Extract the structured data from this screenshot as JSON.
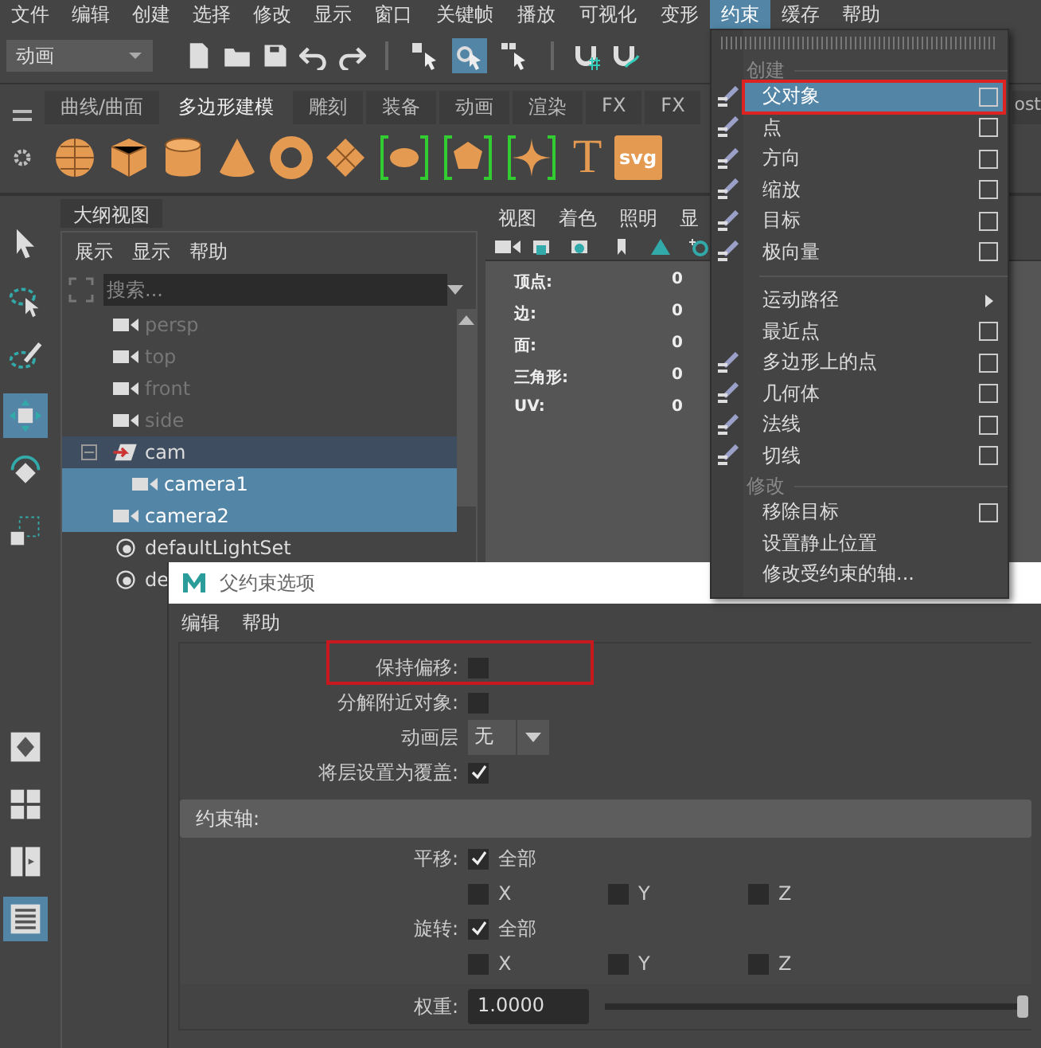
{
  "menubar": [
    {
      "label": "文件",
      "selected": false
    },
    {
      "label": "编辑",
      "selected": false
    },
    {
      "label": "创建",
      "selected": false
    },
    {
      "label": "选择",
      "selected": false
    },
    {
      "label": "修改",
      "selected": false
    },
    {
      "label": "显示",
      "selected": false
    },
    {
      "label": "窗口",
      "selected": false
    },
    {
      "label": "关键帧",
      "selected": false
    },
    {
      "label": "播放",
      "selected": false
    },
    {
      "label": "可视化",
      "selected": false
    },
    {
      "label": "变形",
      "selected": false
    },
    {
      "label": "约束",
      "selected": true
    },
    {
      "label": "缓存",
      "selected": false
    },
    {
      "label": "帮助",
      "selected": false
    }
  ],
  "status_line": {
    "mode": "动画",
    "tools": [
      {
        "kind": "hierarchy",
        "selected": false
      },
      {
        "kind": "object",
        "selected": true
      },
      {
        "kind": "component",
        "selected": false
      }
    ]
  },
  "shelf": {
    "tabs": [
      {
        "label": "曲线/曲面",
        "selected": false
      },
      {
        "label": "多边形建模",
        "selected": true
      },
      {
        "label": "雕刻",
        "selected": false
      },
      {
        "label": "装备",
        "selected": false
      },
      {
        "label": "动画",
        "selected": false
      },
      {
        "label": "渲染",
        "selected": false
      },
      {
        "label": "FX",
        "selected": false
      },
      {
        "label": "FX",
        "selected": false
      },
      {
        "label": "ost",
        "selected": false
      }
    ],
    "icons": [
      {
        "kind": "sphere"
      },
      {
        "kind": "cube"
      },
      {
        "kind": "cylinder"
      },
      {
        "kind": "cone"
      },
      {
        "kind": "torus"
      },
      {
        "kind": "plane"
      },
      {
        "kind": "disc"
      },
      {
        "kind": "platonic"
      },
      {
        "kind": "star"
      },
      {
        "kind": "glyph",
        "glyph": "T"
      },
      {
        "kind": "badge",
        "glyph": "svg"
      }
    ]
  },
  "toolbox": [
    {
      "kind": "select",
      "selected": false
    },
    {
      "kind": "lasso",
      "selected": false
    },
    {
      "kind": "paint",
      "selected": false
    },
    {
      "kind": "move",
      "selected": true
    },
    {
      "kind": "rotate",
      "selected": false
    },
    {
      "kind": "scale",
      "selected": false
    },
    {
      "kind": "single",
      "selected": false
    },
    {
      "kind": "grid",
      "selected": false
    },
    {
      "kind": "split",
      "selected": false
    },
    {
      "kind": "list",
      "selected": true
    }
  ],
  "outliner": {
    "title": "大纲视图",
    "menu": [
      "展示",
      "显示",
      "帮助"
    ],
    "search": {
      "placeholder": "搜索..."
    },
    "items": [
      {
        "label": "persp",
        "kind": "camera",
        "dimmed": true,
        "selected": false
      },
      {
        "label": "top",
        "kind": "camera",
        "dimmed": true,
        "selected": false
      },
      {
        "label": "front",
        "kind": "camera",
        "dimmed": true,
        "selected": false
      },
      {
        "label": "side",
        "kind": "camera",
        "dimmed": true,
        "selected": false
      },
      {
        "label": "cam",
        "kind": "group",
        "dimmed": false,
        "selected": false,
        "expanded": true,
        "children": [
          {
            "label": "camera1",
            "kind": "camera",
            "dimmed": false,
            "selected": true
          }
        ]
      },
      {
        "label": "camera2",
        "kind": "camera",
        "dimmed": false,
        "selected": true
      },
      {
        "label": "defaultLightSet",
        "kind": "set",
        "dimmed": false,
        "selected": false
      },
      {
        "label": "de",
        "kind": "set",
        "dimmed": false,
        "selected": false
      }
    ]
  },
  "viewport": {
    "menu": [
      "视图",
      "着色",
      "照明",
      "显"
    ],
    "stats": [
      {
        "label": "顶点:",
        "value": "0"
      },
      {
        "label": "边:",
        "value": "0"
      },
      {
        "label": "面:",
        "value": "0"
      },
      {
        "label": "三角形:",
        "value": "0"
      },
      {
        "label": "UV:",
        "value": "0"
      }
    ]
  },
  "constrain_menu": {
    "sections": [
      {
        "title": "创建",
        "items": [
          {
            "label": "父对象",
            "kind": "option",
            "icon": true,
            "selected": true,
            "highlighted": true
          },
          {
            "label": "点",
            "kind": "option",
            "icon": true,
            "selected": false,
            "highlighted": false
          },
          {
            "label": "方向",
            "kind": "option",
            "icon": true,
            "selected": false,
            "highlighted": false
          },
          {
            "label": "缩放",
            "kind": "option",
            "icon": true,
            "selected": false,
            "highlighted": false
          },
          {
            "label": "目标",
            "kind": "option",
            "icon": true,
            "selected": false,
            "highlighted": false
          },
          {
            "label": "极向量",
            "kind": "option",
            "icon": true,
            "selected": false,
            "highlighted": false
          },
          {
            "kind": "separator"
          },
          {
            "label": "运动路径",
            "kind": "submenu",
            "icon": false,
            "selected": false,
            "highlighted": false
          },
          {
            "label": "最近点",
            "kind": "option",
            "icon": false,
            "selected": false,
            "highlighted": false
          },
          {
            "label": "多边形上的点",
            "kind": "option",
            "icon": true,
            "selected": false,
            "highlighted": false
          },
          {
            "label": "几何体",
            "kind": "option",
            "icon": true,
            "selected": false,
            "highlighted": false
          },
          {
            "label": "法线",
            "kind": "option",
            "icon": true,
            "selected": false,
            "highlighted": false
          },
          {
            "label": "切线",
            "kind": "option",
            "icon": true,
            "selected": false,
            "highlighted": false
          }
        ]
      },
      {
        "title": "修改",
        "items": [
          {
            "label": "移除目标",
            "kind": "option",
            "icon": false,
            "selected": false,
            "highlighted": false
          },
          {
            "label": "设置静止位置",
            "kind": "plain",
            "icon": false,
            "selected": false,
            "highlighted": false
          },
          {
            "label": "修改受约束的轴...",
            "kind": "plain",
            "icon": false,
            "selected": false,
            "highlighted": false
          }
        ]
      }
    ]
  },
  "dialog": {
    "title": "父约束选项",
    "menu": [
      "编辑",
      "帮助"
    ],
    "options": [
      {
        "kind": "checkbox",
        "label": "保持偏移:",
        "checked": false,
        "highlighted": true
      },
      {
        "kind": "checkbox",
        "label": "分解附近对象:",
        "checked": false,
        "highlighted": false
      },
      {
        "kind": "dropdown",
        "label": "动画层",
        "value": "无"
      },
      {
        "kind": "checkbox",
        "label": "将层设置为覆盖:",
        "checked": true,
        "highlighted": false
      }
    ],
    "axes": {
      "title": "约束轴:",
      "groups": [
        {
          "label": "平移:",
          "all": {
            "label": "全部",
            "checked": true
          },
          "axes": [
            {
              "label": "X",
              "checked": false
            },
            {
              "label": "Y",
              "checked": false
            },
            {
              "label": "Z",
              "checked": false
            }
          ]
        },
        {
          "label": "旋转:",
          "all": {
            "label": "全部",
            "checked": true
          },
          "axes": [
            {
              "label": "X",
              "checked": false
            },
            {
              "label": "Y",
              "checked": false
            },
            {
              "label": "Z",
              "checked": false
            }
          ]
        }
      ]
    },
    "weight": {
      "label": "权重:",
      "value": "1.0000",
      "level": 1
    }
  }
}
